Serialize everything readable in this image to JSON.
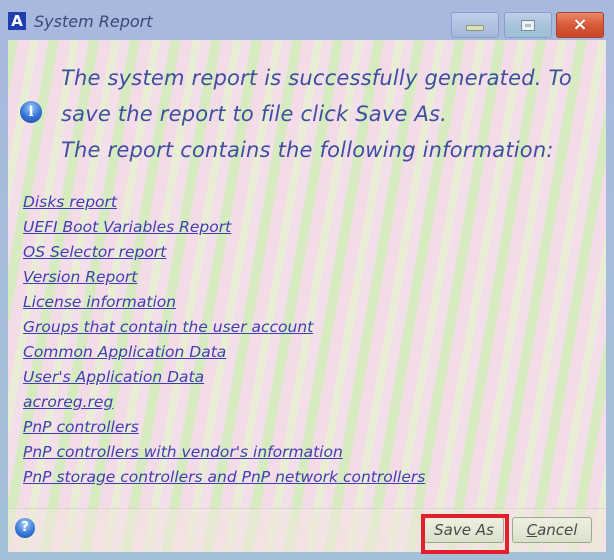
{
  "window": {
    "title": "System Report",
    "app_icon_letter": "A",
    "controls": {
      "minimize": "minimize",
      "maximize": "maximize",
      "close": "×"
    }
  },
  "message": {
    "icon": "info-icon",
    "icon_glyph": "i",
    "lines": [
      "The system report is successfully generated. To",
      "save the report to file click Save As.",
      "The report contains the following information:"
    ]
  },
  "links": [
    "Disks report",
    "UEFI Boot Variables Report",
    "OS Selector report",
    "Version Report",
    "License information",
    "Groups that contain the user account",
    "Common Application Data",
    "User's Application Data",
    "acroreg.reg",
    "PnP controllers",
    "PnP controllers with vendor's information",
    "PnP storage controllers and PnP network controllers"
  ],
  "footer": {
    "help_glyph": "?",
    "save_as_label": "Save As",
    "cancel_accel": "C",
    "cancel_rest": "ancel"
  },
  "colors": {
    "link": "#3f3fb0",
    "message": "#3e4fa0",
    "highlight": "#e0202a",
    "close_button": "#d85a38"
  }
}
